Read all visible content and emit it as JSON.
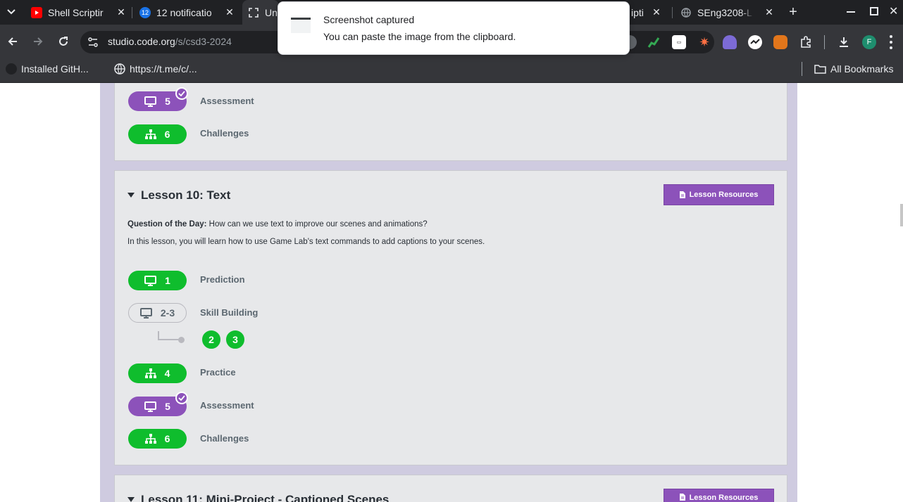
{
  "browser": {
    "tabs": [
      {
        "title": "Shell Scriptir",
        "icon": "youtube-icon"
      },
      {
        "title": "12 notificatio",
        "icon": "notification-badge-icon",
        "badge": "12"
      },
      {
        "title": "Un",
        "icon": "grid-icon"
      },
      {
        "title": "ipti",
        "icon": ""
      },
      {
        "title": "SEng3208-L",
        "icon": "globe-icon"
      }
    ],
    "new_tab": "+",
    "url_host": "studio.code.org",
    "url_path": "/s/csd3-2024",
    "bookmarks": [
      {
        "label": "Installed GitH...",
        "icon": "github-icon"
      },
      {
        "label": "https://t.me/c/...",
        "icon": "globe-icon"
      }
    ],
    "all_bookmarks": "All Bookmarks",
    "profile_initial": "F"
  },
  "notification": {
    "title": "Screenshot captured",
    "body": "You can paste the image from the clipboard."
  },
  "previous_lesson": {
    "levels": [
      {
        "number": "5",
        "label": "Assessment",
        "kind": "assessment",
        "completed": true
      },
      {
        "number": "6",
        "label": "Challenges",
        "kind": "challenge"
      }
    ]
  },
  "lesson10": {
    "title": "Lesson 10: Text",
    "resources_label": "Lesson Resources",
    "question_label": "Question of the Day:",
    "question": "How can we use text to improve our scenes and animations?",
    "description": "In this lesson, you will learn how to use Game Lab's text commands to add captions to your scenes.",
    "levels": [
      {
        "number": "1",
        "label": "Prediction",
        "kind": "prediction"
      },
      {
        "number": "2-3",
        "label": "Skill Building",
        "kind": "skill"
      },
      {
        "number": "4",
        "label": "Practice",
        "kind": "practice"
      },
      {
        "number": "5",
        "label": "Assessment",
        "kind": "assessment",
        "completed": true
      },
      {
        "number": "6",
        "label": "Challenges",
        "kind": "challenge"
      }
    ],
    "sublevels": [
      "2",
      "3"
    ]
  },
  "lesson11": {
    "title": "Lesson 11: Mini-Project - Captioned Scenes",
    "resources_label": "Lesson Resources"
  },
  "colors": {
    "green": "#0fbd2d",
    "purple": "#8c52ba",
    "page_bg": "#cfcbe0",
    "card_bg": "#e7e8ea"
  }
}
